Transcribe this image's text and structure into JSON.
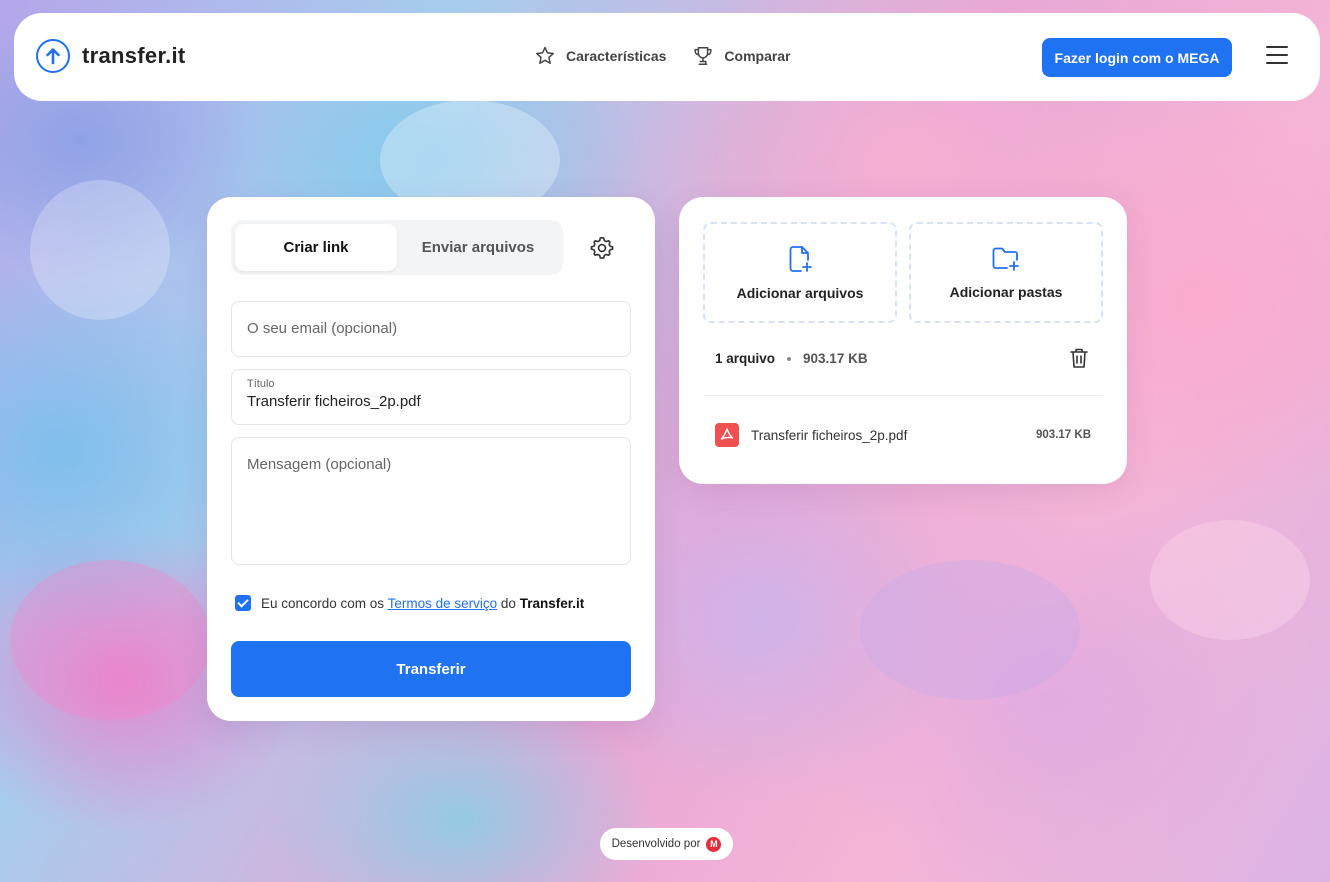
{
  "header": {
    "logo_text": "transfer.it",
    "nav": [
      {
        "label": "Características",
        "icon": "star-icon"
      },
      {
        "label": "Comparar",
        "icon": "trophy-icon"
      }
    ],
    "login_label": "Fazer login com o MEGA"
  },
  "form": {
    "tabs": [
      {
        "label": "Criar link",
        "active": true
      },
      {
        "label": "Enviar arquivos",
        "active": false
      }
    ],
    "email_placeholder": "O seu email (opcional)",
    "title_label": "Título",
    "title_value": "Transferir ficheiros_2p.pdf",
    "message_placeholder": "Mensagem (opcional)",
    "agree_prefix": "Eu concordo com os",
    "agree_link": "Termos de serviço",
    "agree_mid": "do",
    "agree_brand": "Transfer.it",
    "agree_checked": true,
    "submit_label": "Transferir"
  },
  "files": {
    "add_files_label": "Adicionar arquivos",
    "add_folders_label": "Adicionar pastas",
    "count_label": "1 arquivo",
    "total_size": "903.17 KB",
    "items": [
      {
        "name": "Transferir ficheiros_2p.pdf",
        "size": "903.17 KB",
        "icon": "pdf-icon"
      }
    ]
  },
  "footer": {
    "powered_label": "Desenvolvido por",
    "brand_letter": "M"
  },
  "colors": {
    "accent": "#1f72f2",
    "pdf": "#f05050",
    "mega": "#e52d3c"
  }
}
